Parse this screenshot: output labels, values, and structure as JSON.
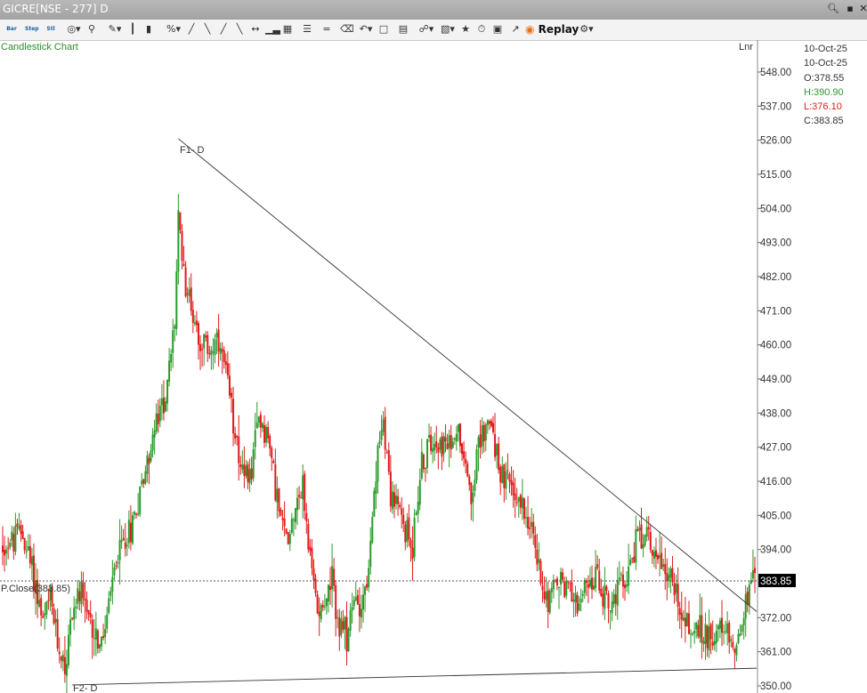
{
  "window": {
    "title": "GICRE[NSE - 277] D",
    "controls": [
      "search-icon",
      "minimize-icon",
      "close-icon"
    ]
  },
  "toolbar": {
    "items": [
      "bar-chart-icon",
      "step-chart-icon",
      "line-chart-icon",
      "target-icon",
      "pin-icon",
      "pen-icon",
      "ohlc-icon",
      "percent-icon",
      "draw-icon",
      "ruler-icon",
      "trendline-icon",
      "arrow-icon",
      "volume-icon",
      "cube-icon",
      "fib-icon",
      "parallel-icon",
      "eraser-icon",
      "undo-icon",
      "note-icon",
      "doc-icon",
      "link-icon",
      "layout-icon",
      "star-icon",
      "alert-icon",
      "delete-icon",
      "indicator-icon"
    ],
    "small_labels": [
      "Bar",
      "Step",
      "Stl"
    ],
    "replay_label": "Replay",
    "settings": "gear-icon"
  },
  "chart_label": "Candlestick Chart",
  "scale_mode": "Lnr",
  "ohlc": {
    "date1": "10-Oct-25",
    "date2": "10-Oct-25",
    "open": "O:378.55",
    "high": "H:390.90",
    "low": "L:376.10",
    "close": "C:383.85"
  },
  "colors": {
    "up": "#2a9a2a",
    "down": "#e21a1a",
    "trend": "#333333",
    "high_color": "#2a9a2a",
    "low_color": "#e21a1a"
  },
  "chart_data": {
    "type": "candlestick",
    "symbol": "GICRE",
    "y_axis_ticks": [
      "548.00",
      "537.00",
      "526.00",
      "515.00",
      "504.00",
      "493.00",
      "482.00",
      "471.00",
      "460.00",
      "449.00",
      "438.00",
      "427.00",
      "416.00",
      "405.00",
      "394.00",
      "383.85",
      "372.00",
      "361.00",
      "350.00"
    ],
    "ylim": [
      348,
      553
    ],
    "last_price": 383.85,
    "prev_close_label": "P.Close(383.85)",
    "fractal_labels": [
      "F1- D",
      "F2- D"
    ],
    "trendlines": [
      {
        "name": "resistance",
        "from_bar": 0,
        "from_price": 526.5,
        "to_bar": 1,
        "to_price": 374
      },
      {
        "name": "support",
        "from_bar": 0,
        "from_price": 350.3,
        "to_bar": 1,
        "to_price": 355.7
      }
    ],
    "anchors": [
      [
        0,
        395
      ],
      [
        6,
        397
      ],
      [
        10,
        400
      ],
      [
        16,
        388
      ],
      [
        22,
        370
      ],
      [
        26,
        378
      ],
      [
        30,
        364
      ],
      [
        34,
        356
      ],
      [
        38,
        374
      ],
      [
        42,
        380
      ],
      [
        46,
        372
      ],
      [
        50,
        368
      ],
      [
        54,
        362
      ],
      [
        58,
        376
      ],
      [
        62,
        390
      ],
      [
        66,
        397
      ],
      [
        70,
        401
      ],
      [
        74,
        410
      ],
      [
        78,
        420
      ],
      [
        82,
        430
      ],
      [
        86,
        438
      ],
      [
        90,
        447
      ],
      [
        94,
        468
      ],
      [
        96,
        500
      ],
      [
        100,
        480
      ],
      [
        104,
        470
      ],
      [
        108,
        462
      ],
      [
        112,
        458
      ],
      [
        116,
        460
      ],
      [
        120,
        456
      ],
      [
        124,
        442
      ],
      [
        128,
        430
      ],
      [
        132,
        415
      ],
      [
        136,
        420
      ],
      [
        140,
        437
      ],
      [
        144,
        432
      ],
      [
        148,
        420
      ],
      [
        152,
        402
      ],
      [
        156,
        398
      ],
      [
        160,
        410
      ],
      [
        164,
        414
      ],
      [
        168,
        390
      ],
      [
        172,
        376
      ],
      [
        176,
        378
      ],
      [
        180,
        383
      ],
      [
        184,
        368
      ],
      [
        188,
        366
      ],
      [
        192,
        377
      ],
      [
        196,
        377
      ],
      [
        200,
        386
      ],
      [
        204,
        418
      ],
      [
        208,
        438
      ],
      [
        212,
        412
      ],
      [
        216,
        407
      ],
      [
        220,
        400
      ],
      [
        224,
        396
      ],
      [
        228,
        418
      ],
      [
        232,
        426
      ],
      [
        236,
        432
      ],
      [
        240,
        428
      ],
      [
        244,
        426
      ],
      [
        248,
        434
      ],
      [
        252,
        426
      ],
      [
        256,
        412
      ],
      [
        260,
        426
      ],
      [
        264,
        436
      ],
      [
        268,
        432
      ],
      [
        272,
        418
      ],
      [
        276,
        415
      ],
      [
        280,
        412
      ],
      [
        284,
        408
      ],
      [
        288,
        404
      ],
      [
        292,
        390
      ],
      [
        296,
        380
      ],
      [
        300,
        380
      ],
      [
        304,
        384
      ],
      [
        308,
        382
      ],
      [
        312,
        380
      ],
      [
        316,
        377
      ],
      [
        320,
        382
      ],
      [
        324,
        385
      ],
      [
        328,
        380
      ],
      [
        332,
        376
      ],
      [
        336,
        380
      ],
      [
        340,
        384
      ],
      [
        344,
        392
      ],
      [
        348,
        400
      ],
      [
        352,
        398
      ],
      [
        356,
        394
      ],
      [
        360,
        390
      ],
      [
        364,
        386
      ],
      [
        368,
        380
      ],
      [
        372,
        372
      ],
      [
        376,
        368
      ],
      [
        380,
        368
      ],
      [
        384,
        366
      ],
      [
        388,
        368
      ],
      [
        392,
        366
      ],
      [
        396,
        366
      ],
      [
        400,
        363
      ],
      [
        404,
        370
      ],
      [
        408,
        381
      ],
      [
        410,
        383.85
      ]
    ]
  }
}
